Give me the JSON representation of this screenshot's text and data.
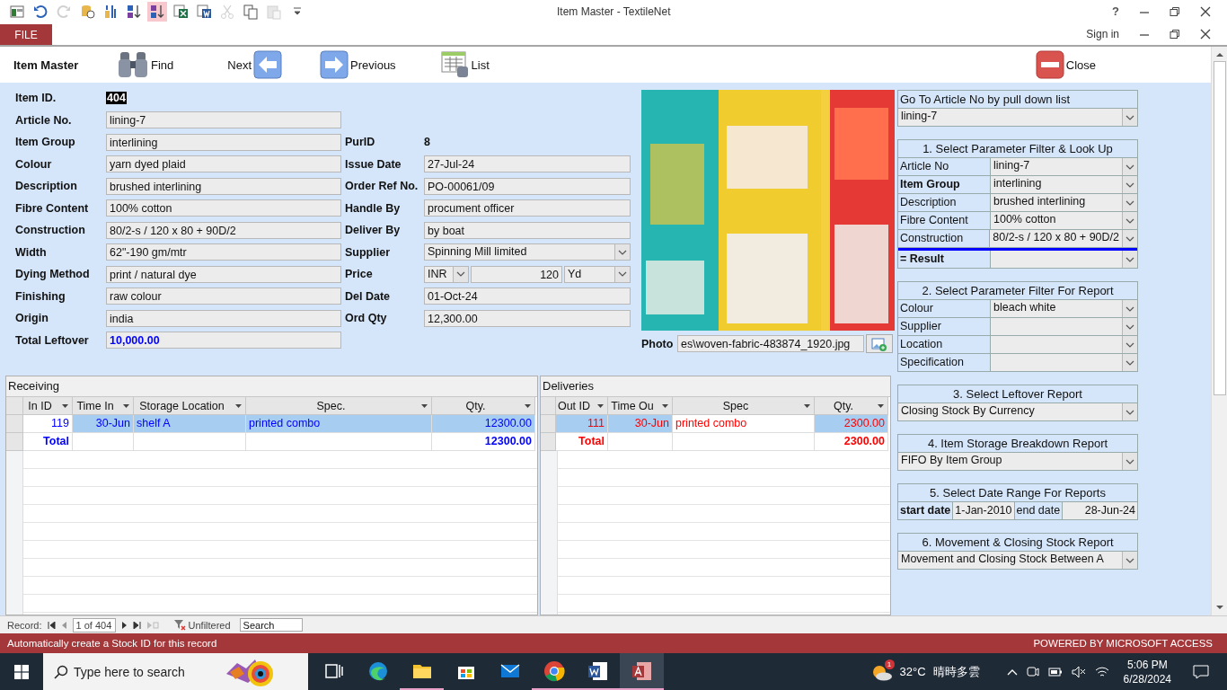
{
  "window": {
    "title": "Item Master - TextileNet",
    "help": "?"
  },
  "quick_access": [
    {
      "kind": "app",
      "selected": false,
      "disabled": false
    },
    {
      "kind": "undo",
      "selected": false,
      "disabled": false
    },
    {
      "kind": "redo",
      "selected": false,
      "disabled": true
    },
    {
      "kind": "database",
      "selected": false,
      "disabled": false
    },
    {
      "kind": "properties",
      "selected": false,
      "disabled": false
    },
    {
      "kind": "sort-ascending",
      "selected": false,
      "disabled": false
    },
    {
      "kind": "sort-descending",
      "selected": true,
      "disabled": false
    },
    {
      "kind": "excel",
      "selected": false,
      "disabled": false
    },
    {
      "kind": "word",
      "selected": false,
      "disabled": false
    },
    {
      "kind": "cut",
      "selected": false,
      "disabled": true
    },
    {
      "kind": "copy",
      "selected": false,
      "disabled": false
    },
    {
      "kind": "paste",
      "selected": false,
      "disabled": true
    },
    {
      "kind": "customize",
      "selected": false,
      "disabled": false
    }
  ],
  "ribbon": {
    "file_tab": "FILE",
    "sign_in": "Sign in"
  },
  "form_header": {
    "title": "Item Master",
    "buttons": [
      {
        "kind": "find",
        "label": "Find"
      },
      {
        "kind": "next",
        "label": "Next"
      },
      {
        "kind": "previous",
        "label": "Previous"
      },
      {
        "kind": "list",
        "label": "List"
      },
      {
        "kind": "close",
        "label": "Close"
      }
    ]
  },
  "left_fields": [
    {
      "label": "Item ID.",
      "value": "404",
      "kind": "id"
    },
    {
      "label": "Article No.",
      "value": "lining-7",
      "kind": "text"
    },
    {
      "label": "Item Group",
      "value": "interlining",
      "kind": "text"
    },
    {
      "label": "Colour",
      "value": "yarn dyed plaid",
      "kind": "text"
    },
    {
      "label": "Description",
      "value": "brushed interlining",
      "kind": "text"
    },
    {
      "label": "Fibre Content",
      "value": "100% cotton",
      "kind": "text"
    },
    {
      "label": "Construction",
      "value": "80/2-s / 120 x 80 + 90D/2",
      "kind": "text"
    },
    {
      "label": "Width",
      "value": "62\"-190 gm/mtr",
      "kind": "text"
    },
    {
      "label": "Dying Method",
      "value": "print / natural dye",
      "kind": "text"
    },
    {
      "label": "Finishing",
      "value": "raw colour",
      "kind": "text"
    },
    {
      "label": "Origin",
      "value": "india",
      "kind": "text"
    },
    {
      "label": "Total Leftover",
      "value": "10,000.00",
      "kind": "total"
    }
  ],
  "right_fields": [
    {
      "label": "PurID",
      "value": "8",
      "kind": "plain"
    },
    {
      "label": "Issue Date",
      "value": "27-Jul-24",
      "kind": "text"
    },
    {
      "label": "Order Ref No.",
      "value": "PO-00061/09",
      "kind": "text"
    },
    {
      "label": "Handle By",
      "value": "procument officer",
      "kind": "text"
    },
    {
      "label": "Deliver By",
      "value": "by boat",
      "kind": "text"
    },
    {
      "label": "Supplier",
      "value": "Spinning Mill limited",
      "kind": "combo"
    },
    {
      "label": "Price",
      "kind": "price",
      "currency": "INR",
      "amount": "120",
      "unit": "Yd"
    },
    {
      "label": "Del Date",
      "value": "01-Oct-24",
      "kind": "text"
    },
    {
      "label": "Ord Qty",
      "value": "12,300.00",
      "kind": "text"
    }
  ],
  "photo": {
    "kind": "picture",
    "label": "Photo",
    "path": "es\\woven-fabric-483874_1920.jpg"
  },
  "goto": {
    "title": "Go To Article No by pull down list",
    "value": "lining-7"
  },
  "filter_lookup": {
    "title": "1. Select Parameter Filter & Look Up",
    "rows": [
      {
        "label": "Article No",
        "value": "lining-7",
        "emphasis": false
      },
      {
        "label": "Item Group",
        "value": "interlining",
        "emphasis": true
      },
      {
        "label": "Description",
        "value": "brushed interlining",
        "emphasis": false
      },
      {
        "label": "Fibre Content",
        "value": "100% cotton",
        "emphasis": false
      },
      {
        "label": "Construction",
        "value": "80/2-s / 120 x 80 + 90D/2",
        "emphasis": false
      }
    ],
    "result": {
      "label": "= Result"
    }
  },
  "filter_report": {
    "title": "2. Select Parameter Filter For Report",
    "rows": [
      {
        "label": "Colour",
        "value": "bleach white",
        "emphasis": false
      },
      {
        "label": "Supplier",
        "emphasis": false
      },
      {
        "label": "Location",
        "emphasis": false
      },
      {
        "label": "Specification",
        "emphasis": false
      }
    ]
  },
  "reports": [
    {
      "title": "3. Select Leftover Report",
      "value": "Closing Stock By Currency"
    },
    {
      "title": "4. Item Storage Breakdown Report",
      "value": "FIFO By Item Group"
    }
  ],
  "date_range": {
    "title": "5. Select Date Range For  Reports",
    "start_label": "start date",
    "start": "1-Jan-2010",
    "end_label": "end date",
    "end": "28-Jun-24"
  },
  "movement_report": {
    "title": "6. Movement & Closing Stock Report",
    "value": "Movement and Closing Stock Between A"
  },
  "subforms": [
    {
      "title": "Receiving",
      "color": "#0000ff",
      "columns": [
        "In ID",
        "Time In",
        "Storage Location",
        "Spec.",
        "Qty."
      ],
      "rows": [
        {
          "cells": [
            "119",
            "30-Jun",
            "shelf A",
            "printed combo",
            "12300.00"
          ],
          "selected": true
        }
      ],
      "total": {
        "label": "Total",
        "qty": "12300.00"
      }
    },
    {
      "title": "Deliveries",
      "color": "#ff0000",
      "columns": [
        "Out ID",
        "Time Ou",
        "Spec",
        "Qty."
      ],
      "rows": [
        {
          "cells": [
            "111",
            "30-Jun",
            "printed combo",
            "2300.00"
          ],
          "selected": true
        }
      ],
      "total": {
        "label": "Total",
        "qty": "2300.00"
      }
    }
  ],
  "record_nav": {
    "label": "Record:",
    "position": "1 of 404",
    "filter": "Unfiltered",
    "search_placeholder": "Search"
  },
  "status_bar": {
    "message": "Automatically create a Stock ID for this record",
    "powered": "POWERED BY MICROSOFT ACCESS"
  },
  "taskbar": {
    "search_placeholder": "Type here to search",
    "apps": [
      {
        "kind": "task-view",
        "running": false,
        "selected": false
      },
      {
        "kind": "edge",
        "running": false,
        "selected": false
      },
      {
        "kind": "explorer",
        "running": true,
        "selected": false
      },
      {
        "kind": "store",
        "running": false,
        "selected": false
      },
      {
        "kind": "mail",
        "running": false,
        "selected": false
      },
      {
        "kind": "chrome",
        "running": true,
        "selected": false
      },
      {
        "kind": "word",
        "running": true,
        "selected": false
      },
      {
        "kind": "access",
        "running": true,
        "selected": true
      }
    ],
    "weather": {
      "badge": "1",
      "temperature": "32°C",
      "condition": "晴時多雲"
    },
    "time": "5:06 PM",
    "date": "6/28/2024"
  }
}
